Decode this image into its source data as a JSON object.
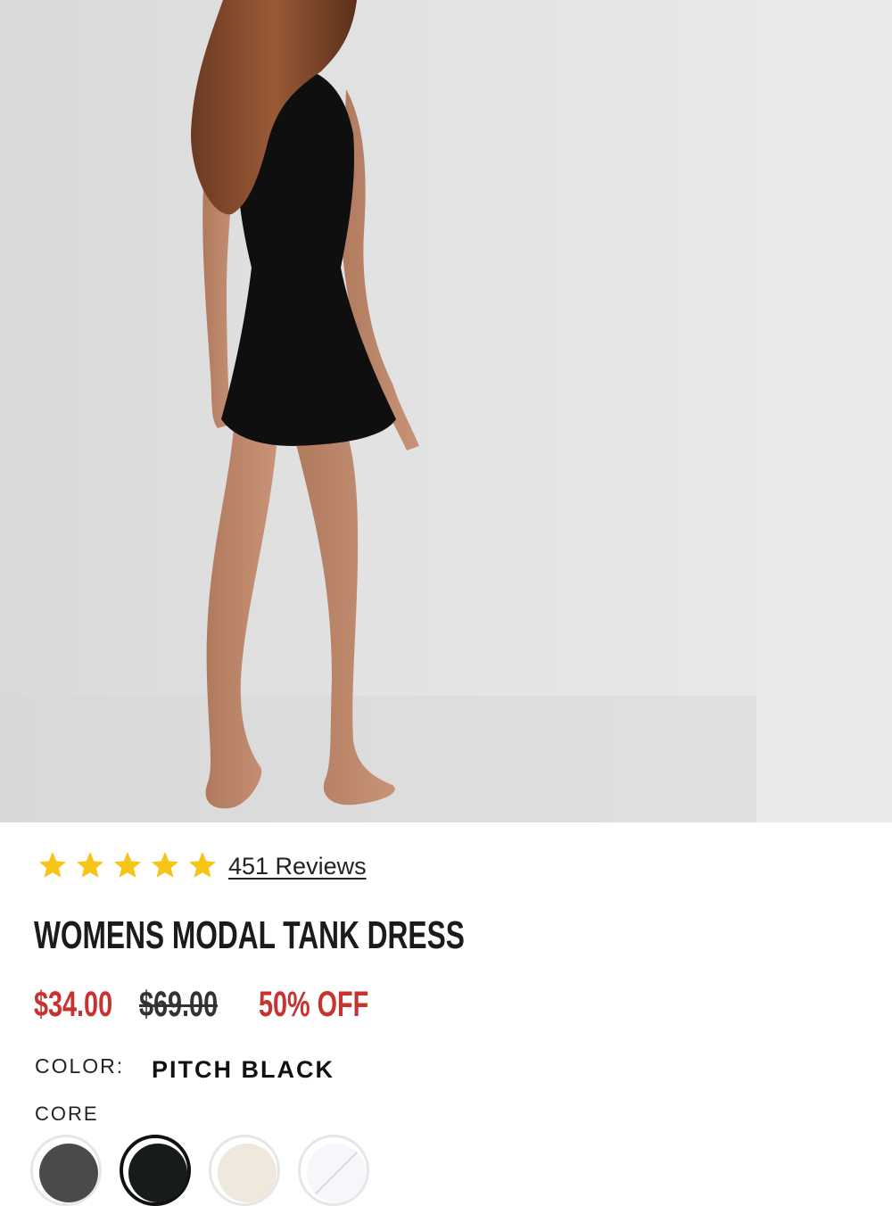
{
  "product": {
    "title": "WOMENS MODAL TANK DRESS",
    "rating_stars": 5,
    "reviews_label": "451 Reviews",
    "price": {
      "sale": "$34.00",
      "original": "$69.00",
      "discount": "50% OFF"
    },
    "color": {
      "label": "COLOR:",
      "selected": "PITCH BLACK",
      "group_label": "CORE"
    },
    "swatches": [
      {
        "name": "charcoal",
        "hex": "#4a4a4a",
        "selected": false
      },
      {
        "name": "pitch-black",
        "hex": "#161b1c",
        "selected": true
      },
      {
        "name": "cream",
        "hex": "#efe8dd",
        "selected": false
      },
      {
        "name": "white",
        "hex": "#f7f7fb",
        "selected": false
      }
    ]
  },
  "colors": {
    "star": "#f5c518",
    "sale_red": "#c8322f",
    "text": "#1b1b1b"
  }
}
